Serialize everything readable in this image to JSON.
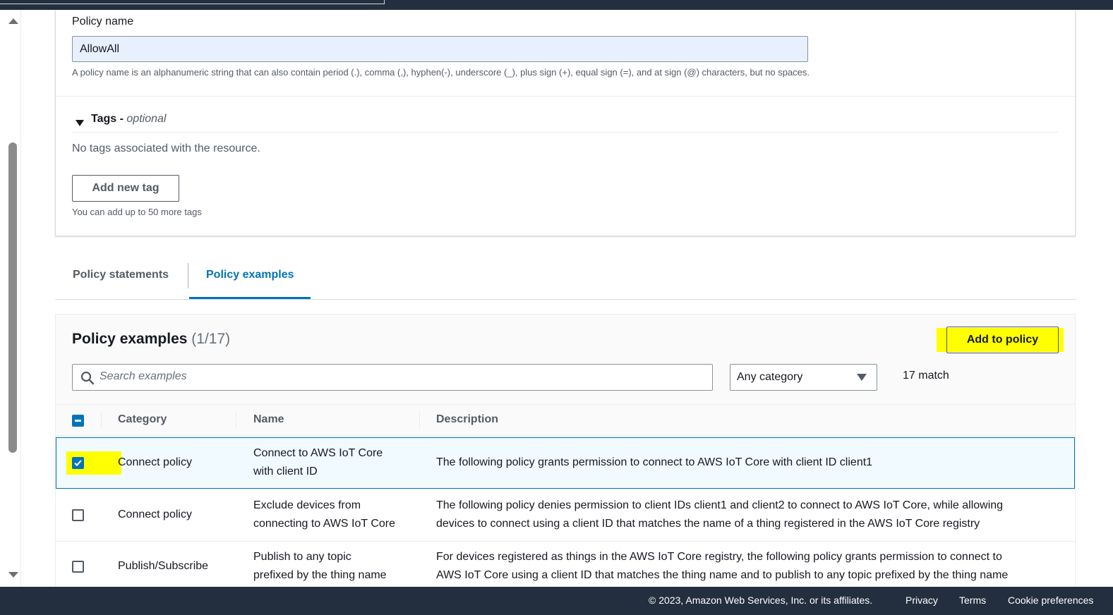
{
  "form": {
    "policy_name_label": "Policy name",
    "policy_name_value": "AllowAll",
    "policy_name_hint": "A policy name is an alphanumeric string that can also contain period (.), comma (,), hyphen(-), underscore (_), plus sign (+), equal sign (=), and at sign (@) characters, but no spaces.",
    "tags_label": "Tags -",
    "tags_optional": "optional",
    "no_tags_text": "No tags associated with the resource.",
    "add_tag_button": "Add new tag",
    "tags_hint": "You can add up to 50 more tags"
  },
  "tabs": [
    {
      "label": "Policy statements",
      "active": false
    },
    {
      "label": "Policy examples",
      "active": true
    }
  ],
  "examples": {
    "title": "Policy examples",
    "count": "(1/17)",
    "add_button": "Add to policy",
    "search_placeholder": "Search examples",
    "category_selected": "Any category",
    "match_text": "17 match",
    "columns": [
      "Category",
      "Name",
      "Description"
    ],
    "rows": [
      {
        "checked": true,
        "category": "Connect policy",
        "name_line1": "Connect to AWS IoT Core",
        "name_line2": "with client ID",
        "desc_line1": "The following policy grants permission to connect to AWS IoT Core with client ID client1",
        "desc_line2": ""
      },
      {
        "checked": false,
        "category": "Connect policy",
        "name_line1": "Exclude devices from",
        "name_line2": "connecting to AWS IoT Core",
        "desc_line1": "The following policy denies permission to client IDs client1 and client2 to connect to AWS IoT Core, while allowing",
        "desc_line2": "devices to connect using a client ID that matches the name of a thing registered in the AWS IoT Core registry"
      },
      {
        "checked": false,
        "category": "Publish/Subscribe",
        "name_line1": "Publish to any topic",
        "name_line2": "prefixed by the thing name",
        "desc_line1": "For devices registered as things in the AWS IoT Core registry, the following policy grants permission to connect to",
        "desc_line2": "AWS IoT Core using a client ID that matches the thing name and to publish to any topic prefixed by the thing name"
      }
    ]
  },
  "footer": {
    "copyright": "© 2023, Amazon Web Services, Inc. or its affiliates.",
    "privacy": "Privacy",
    "terms": "Terms",
    "cookies": "Cookie preferences"
  },
  "colors": {
    "accent": "#0073bb",
    "highlight": "#ffff00",
    "header_bg": "#232f3e"
  }
}
